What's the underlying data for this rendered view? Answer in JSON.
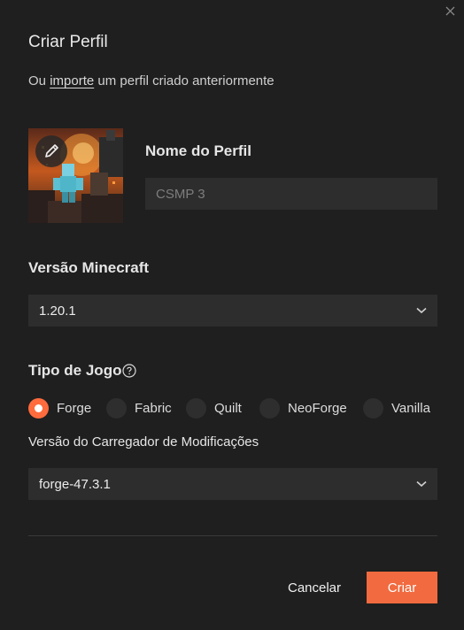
{
  "dialog": {
    "title": "Criar Perfil",
    "subtitle_prefix": "Ou ",
    "subtitle_link": "importe",
    "subtitle_suffix": " um perfil criado anteriormente"
  },
  "profile": {
    "name_label": "Nome do Perfil",
    "name_placeholder": "CSMP 3",
    "name_value": ""
  },
  "minecraft_version": {
    "label": "Versão Minecraft",
    "selected": "1.20.1"
  },
  "game_type": {
    "label": "Tipo de Jogo",
    "options": [
      "Forge",
      "Fabric",
      "Quilt",
      "NeoForge",
      "Vanilla"
    ],
    "selected": "Forge"
  },
  "loader_version": {
    "label": "Versão do Carregador de Modificações",
    "selected": "forge-47.3.1"
  },
  "buttons": {
    "cancel": "Cancelar",
    "create": "Criar"
  },
  "icons": {
    "close": "close-icon",
    "edit": "pencil-icon",
    "help": "help-circle-icon",
    "chevron": "chevron-down-icon"
  },
  "colors": {
    "accent": "#f26a3f",
    "background": "#1f1f1f",
    "field": "#2d2d2d"
  }
}
